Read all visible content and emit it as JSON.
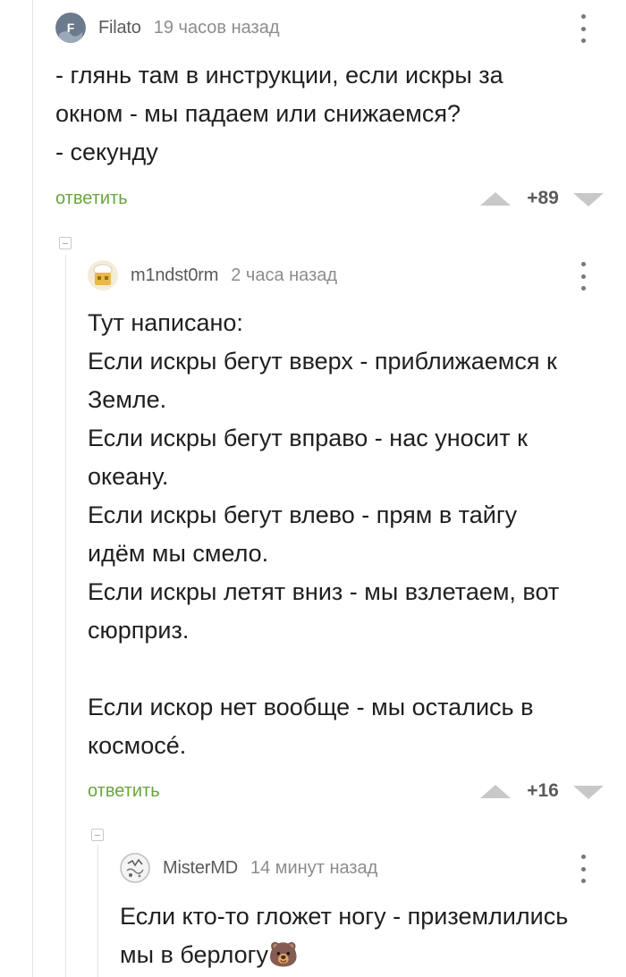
{
  "comments": [
    {
      "author": "Filato",
      "avatar_letter": "F",
      "time": "19 часов назад",
      "text": "- глянь там в инструкции, если искры за\nокном - мы падаем или снижаемся?\n- секунду",
      "reply_label": "ответить",
      "rating": "+89"
    },
    {
      "author": "m1ndst0rm",
      "time": "2 часа назад",
      "text": "Тут написано:\nЕсли искры бегут вверх - приближаемся к\nЗемле.\nЕсли искры бегут вправо - нас уносит к\nокеану.\nЕсли искры бегут влево - прям в тайгу\nидём мы смело.\nЕсли искры летят вниз - мы взлетаем, вот\nсюрприз.\n\nЕсли искор нет вообще - мы остались в\nкосмосé.",
      "reply_label": "ответить",
      "rating": "+16"
    },
    {
      "author": "MisterMD",
      "time": "14 минут назад",
      "text": "Если кто-то гложет ногу - приземлились\nмы в берлогу🐻"
    }
  ],
  "colors": {
    "reply": "#67a53d",
    "vote": "#c8c8c8",
    "thread_line": "#e3e3e3"
  }
}
